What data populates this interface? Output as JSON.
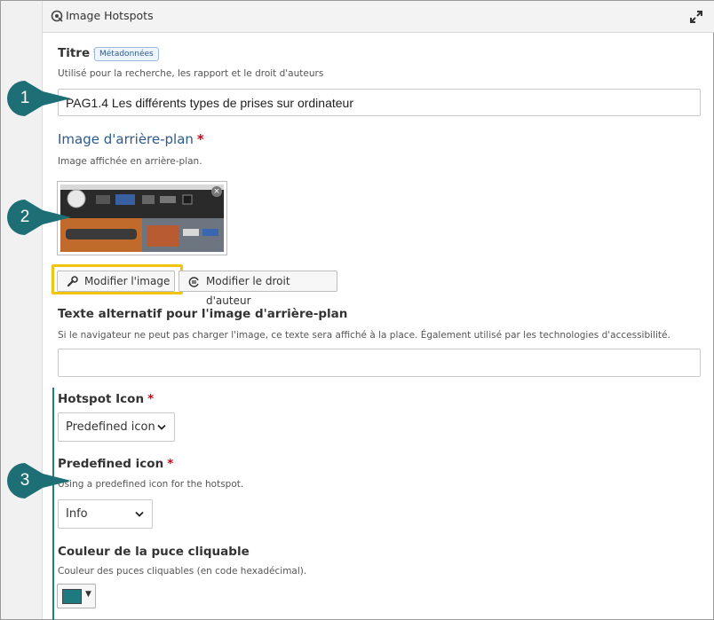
{
  "panel": {
    "title": "Image Hotspots"
  },
  "titre": {
    "label": "Titre",
    "badge": "Métadonnées",
    "description": "Utilisé pour la recherche, les rapport et le droit d'auteurs",
    "value": "PAG1.4 Les différents types de prises sur ordinateur"
  },
  "background_image": {
    "label": "Image d'arrière-plan",
    "description": "Image affichée en arrière-plan.",
    "edit_button": "Modifier l'image",
    "copyright_button": "Modifier le droit d'auteur"
  },
  "alt_text": {
    "label": "Texte alternatif pour l'image d'arrière-plan",
    "description": "Si le navigateur ne peut pas charger l'image, ce texte sera affiché à la place. Également utilisé par les technologies d'accessibilité.",
    "value": ""
  },
  "hotspot_icon": {
    "label": "Hotspot Icon",
    "selected": "Predefined icon"
  },
  "predefined_icon": {
    "label": "Predefined icon",
    "description": "Using a predefined icon for the hotspot.",
    "selected": "Info"
  },
  "hotspot_color": {
    "label": "Couleur de la puce cliquable",
    "description": "Couleur des puces cliquables (en code hexadécimal).",
    "color": "#1f7a80"
  },
  "required_marker": "*",
  "callouts": [
    "1",
    "2",
    "3"
  ],
  "colors": {
    "callout": "#1d6f75",
    "accent_line": "#1f7f7f",
    "highlight": "#f1c40f",
    "required": "#d0021b"
  }
}
